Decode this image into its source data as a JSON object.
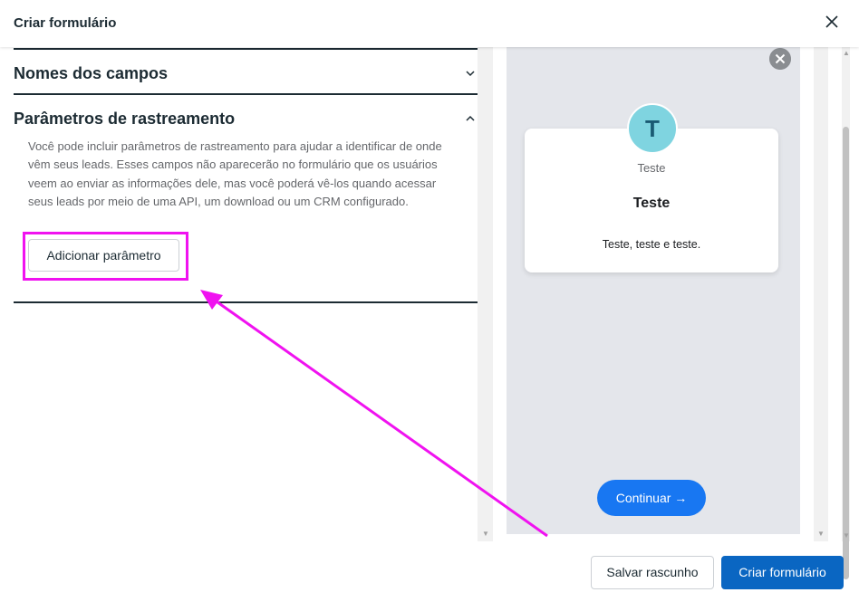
{
  "header": {
    "title": "Criar formulário"
  },
  "sections": {
    "field_names": {
      "title": "Nomes dos campos"
    },
    "tracking": {
      "title": "Parâmetros de rastreamento",
      "description": "Você pode incluir parâmetros de rastreamento para ajudar a identificar de onde vêm seus leads. Esses campos não aparecerão no formulário que os usuários veem ao enviar as informações dele, mas você poderá vê-los quando acessar seus leads por meio de uma API, um download ou um CRM configurado.",
      "add_button": "Adicionar parâmetro"
    }
  },
  "preview": {
    "avatar_letter": "T",
    "page_name": "Teste",
    "form_title": "Teste",
    "form_description": "Teste, teste e teste.",
    "continue_label": "Continuar →"
  },
  "footer": {
    "save_draft": "Salvar rascunho",
    "create_form": "Criar formulário"
  },
  "colors": {
    "primary": "#0a66c2",
    "preview_button": "#1877f2",
    "annotation": "#f012f0",
    "avatar": "#7fd4e0"
  }
}
